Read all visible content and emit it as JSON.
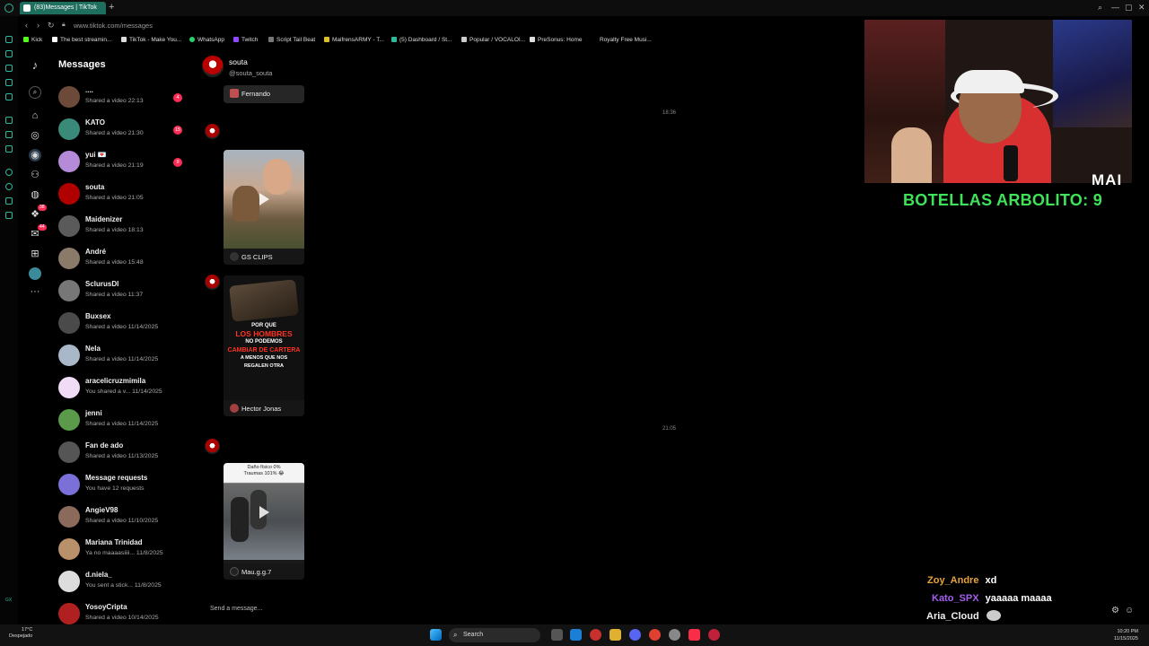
{
  "browser": {
    "tab_title": "(83)Messages | TikTok",
    "new_tab_icon": "+",
    "url": "www.tiktok.com/messages",
    "bookmarks": [
      "Kick",
      "The best streamin...",
      "TikTok - Make You...",
      "WhatsApp",
      "Twitch",
      "Script Tail Beat",
      "MaifrensARMY - T...",
      "(5) Dashboard / St...",
      "Popular / VOCALOI...",
      "PreSonus: Home",
      "Royalty Free Musi..."
    ]
  },
  "tiktok": {
    "header": "Messages",
    "rail_badges": [
      "38",
      "44"
    ],
    "conversations": [
      {
        "name": "....",
        "sub": "Shared a video 22:13",
        "badge": "4",
        "color": "#6b4a3a"
      },
      {
        "name": "KATO",
        "sub": "Shared a video 21:30",
        "badge": "15",
        "color": "#3a8a7a"
      },
      {
        "name": "yui 💌",
        "sub": "Shared a video 21:19",
        "badge": "9",
        "color": "#b58ad8"
      },
      {
        "name": "souta",
        "sub": "Shared a video 21:05",
        "badge": "",
        "color": "#b00000"
      },
      {
        "name": "Maidenizer",
        "sub": "Shared a video 18:13",
        "badge": "",
        "color": "#5a5a5a"
      },
      {
        "name": "André",
        "sub": "Shared a video 15:48",
        "badge": "",
        "color": "#8a7a6a"
      },
      {
        "name": "SclurusDI",
        "sub": "Shared a video 11:37",
        "badge": "",
        "color": "#777"
      },
      {
        "name": "Buxsex",
        "sub": "Shared a video 11/14/2025",
        "badge": "",
        "color": "#4a4a4a"
      },
      {
        "name": "Nela",
        "sub": "Shared a video 11/14/2025",
        "badge": "",
        "color": "#a8b8c8"
      },
      {
        "name": "aracelicruzmimila",
        "sub": "You shared a v... 11/14/2025",
        "badge": "",
        "color": "#f0dcf5"
      },
      {
        "name": "jenni",
        "sub": "Shared a video 11/14/2025",
        "badge": "",
        "color": "#5a9a4a"
      },
      {
        "name": "Fan de ado",
        "sub": "Shared a video 11/13/2025",
        "badge": "",
        "color": "#555"
      },
      {
        "name": "Message requests",
        "sub": "You have 12 requests",
        "badge": "",
        "color": "#7b6fd8"
      },
      {
        "name": "AngieV98",
        "sub": "Shared a video 11/10/2025",
        "badge": "",
        "color": "#8a6a5a"
      },
      {
        "name": "Mariana Trinidad",
        "sub": "Ya no maaaasiiii... 11/8/2025",
        "badge": "",
        "color": "#b8906a"
      },
      {
        "name": "d.niela_",
        "sub": "You sent a stick... 11/8/2025",
        "badge": "",
        "color": "#ddd"
      },
      {
        "name": "YosoyCripta",
        "sub": "Shared a video 10/14/2025",
        "badge": "",
        "color": "#b02020"
      }
    ],
    "chat": {
      "name": "souta",
      "handle": "@souta_souta",
      "cards": [
        {
          "caption": "Fernando"
        },
        {
          "caption": "GS CLIPS"
        },
        {
          "caption": "Hector Jonas",
          "overlay": [
            "POR QUE",
            "LOS HOMBRES",
            "NO PODEMOS",
            "CAMBIAR DE CARTERA",
            "A MENOS QUE NOS",
            "REGALEN OTRA"
          ]
        },
        {
          "caption": "Mau.g.g.7",
          "overlay": [
            "Daño físico 0%",
            "Traumas 101% 😂"
          ]
        }
      ],
      "timestamps": [
        "18:36",
        "21:05"
      ],
      "input_placeholder": "Send a message..."
    }
  },
  "stream": {
    "cam_tag": "MAI",
    "counter": "BOTELLAS ARBOLITO: 9",
    "chat": [
      {
        "user": "Zoy_Andre",
        "msg": "xd",
        "color": "#e8a33a"
      },
      {
        "user": "Kato_SPX",
        "msg": "yaaaaa maaaa",
        "color": "#a45ff0"
      },
      {
        "user": "Aria_Cloud",
        "msg": "",
        "color": "#f0f0f0"
      }
    ]
  },
  "taskbar": {
    "search": "Search",
    "weather_temp": "17°C",
    "weather_desc": "Despejado",
    "time": "10:20 PM",
    "date": "11/15/2025"
  }
}
